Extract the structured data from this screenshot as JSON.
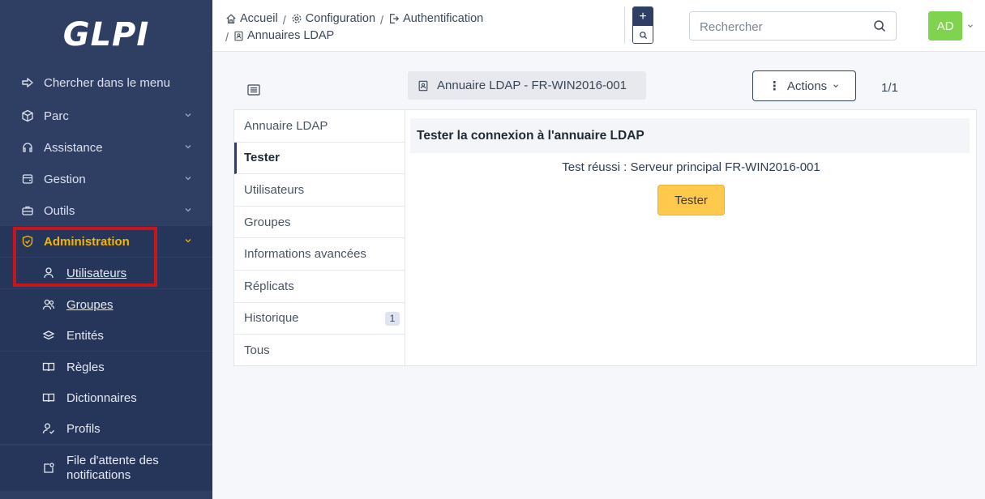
{
  "app": {
    "logo_text": "GLPI"
  },
  "sidebar": {
    "search_label": "Chercher dans le menu",
    "items": [
      {
        "label": "Parc",
        "icon": "box-icon"
      },
      {
        "label": "Assistance",
        "icon": "headset-icon"
      },
      {
        "label": "Gestion",
        "icon": "wallet-icon"
      },
      {
        "label": "Outils",
        "icon": "briefcase-icon"
      },
      {
        "label": "Administration",
        "icon": "shield-icon"
      }
    ],
    "sub_items": [
      {
        "label": "Utilisateurs",
        "icon": "user-icon"
      },
      {
        "label": "Groupes",
        "icon": "users-icon"
      },
      {
        "label": "Entités",
        "icon": "stack-icon"
      },
      {
        "label": "Règles",
        "icon": "book-icon"
      },
      {
        "label": "Dictionnaires",
        "icon": "book-icon"
      },
      {
        "label": "Profils",
        "icon": "user-check-icon"
      },
      {
        "label": "File d'attente des notifications",
        "icon": "notification-icon"
      }
    ]
  },
  "header": {
    "breadcrumb": [
      "Accueil",
      "Configuration",
      "Authentification",
      "Annuaires LDAP"
    ],
    "search_placeholder": "Rechercher",
    "avatar": "AD"
  },
  "toolbar": {
    "item_title": "Annuaire LDAP - FR-WIN2016-001",
    "actions_label": "Actions",
    "pager": "1/1"
  },
  "tabs": [
    {
      "label": "Annuaire LDAP"
    },
    {
      "label": "Tester"
    },
    {
      "label": "Utilisateurs"
    },
    {
      "label": "Groupes"
    },
    {
      "label": "Informations avancées"
    },
    {
      "label": "Réplicats"
    },
    {
      "label": "Historique",
      "badge": "1"
    },
    {
      "label": "Tous"
    }
  ],
  "content": {
    "section_title": "Tester la connexion à l'annuaire LDAP",
    "result": "Test réussi : Serveur principal FR-WIN2016-001",
    "test_button": "Tester"
  },
  "colors": {
    "sidebar_bg": "#2f3f64",
    "active_text": "#f5b400",
    "highlight_border": "#c4161c",
    "test_button_bg": "#ffc94d",
    "avatar_bg": "#7fd34e"
  }
}
